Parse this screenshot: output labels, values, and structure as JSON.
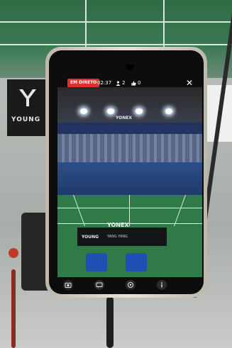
{
  "live_stream": {
    "live_label": "EM DIRETO",
    "elapsed_time": "02:37",
    "viewers_count": "2",
    "likes_count": "0",
    "close_symbol": "✕"
  },
  "controls": {
    "camera_icon": "camera-icon",
    "chat_icon": "chat-icon",
    "share_icon": "share-icon",
    "info_icon": "info-icon"
  },
  "scene_text": {
    "left_banner": "YOUNG",
    "arena_sign": "YONEX",
    "court_logo": "YONEX",
    "ad_board_left": "YOUNG",
    "ad_board_right": "YANG YANG"
  },
  "colors": {
    "live_badge": "#e0302a",
    "court_green": "#2f7a46"
  }
}
